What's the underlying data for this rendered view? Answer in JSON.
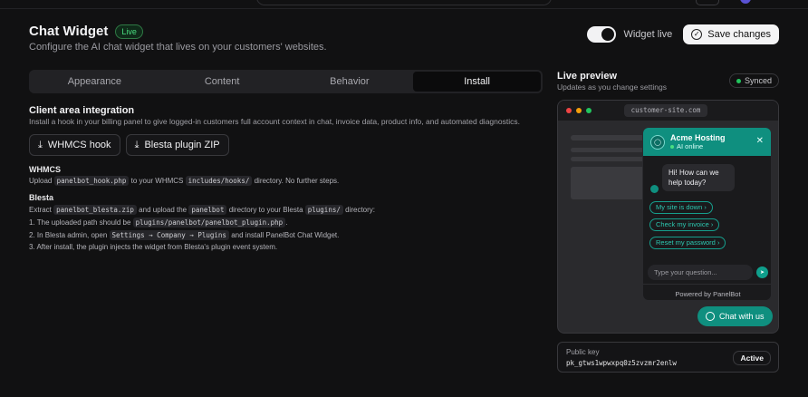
{
  "header": {
    "title": "Chat Widget",
    "badge": "Live",
    "subtitle": "Configure the AI chat widget that lives on your customers' websites.",
    "toggle_label": "Widget live",
    "toggle_on": true,
    "save_label": "Save changes"
  },
  "tabs": [
    {
      "label": "Appearance",
      "active": false
    },
    {
      "label": "Content",
      "active": false
    },
    {
      "label": "Behavior",
      "active": false
    },
    {
      "label": "Install",
      "active": true
    }
  ],
  "install": {
    "title": "Client area integration",
    "description": "Install a hook in your billing panel to give logged-in customers full account context in chat, invoice data, product info, and automated diagnostics.",
    "buttons": {
      "whmcs": "WHMCS hook",
      "blesta": "Blesta plugin ZIP"
    },
    "whmcs": {
      "title": "WHMCS",
      "line_a": "Upload",
      "file": "panelbot_hook.php",
      "line_b": "to your WHMCS",
      "dir": "includes/hooks/",
      "line_c": "directory. No further steps."
    },
    "blesta": {
      "title": "Blesta",
      "extract_a": "Extract",
      "zip": "panelbot_blesta.zip",
      "extract_b": "and upload the",
      "folder": "panelbot",
      "extract_c": "directory to your Blesta",
      "plugins_dir": "plugins/",
      "extract_d": "directory:",
      "step1_a": "1. The uploaded path should be",
      "step1_path": "plugins/panelbot/panelbot_plugin.php",
      "step1_b": ".",
      "step2_a": "2. In Blesta admin, open",
      "step2_path": "Settings → Company → Plugins",
      "step2_b": "and install PanelBot Chat Widget.",
      "step3": "3. After install, the plugin injects the widget from Blesta's plugin event system."
    }
  },
  "preview": {
    "title": "Live preview",
    "subtitle": "Updates as you change settings",
    "status": "Synced",
    "url": "customer-site.com",
    "widget": {
      "name": "Acme Hosting",
      "status": "AI online",
      "greeting": "Hi! How can we help today?",
      "quick_replies": [
        "My site is down",
        "Check my invoice",
        "Reset my password"
      ],
      "input_placeholder": "Type your question...",
      "powered_by": "Powered by PanelBot",
      "launcher_label": "Chat with us",
      "accent_color": "#0f8f7f"
    }
  },
  "public_key": {
    "label": "Public key",
    "value": "pk_gtws1wpwxpq0z5zvzmr2enlw",
    "status": "Active"
  }
}
